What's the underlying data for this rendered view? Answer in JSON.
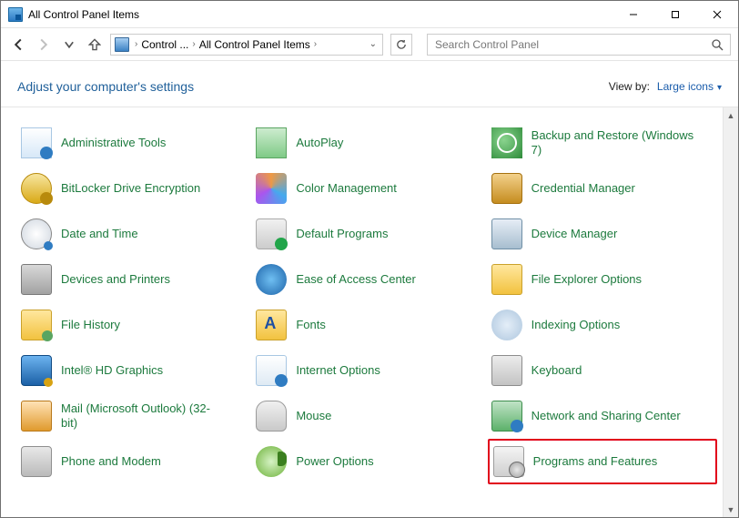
{
  "window": {
    "title": "All Control Panel Items"
  },
  "nav": {
    "crumb1": "Control ...",
    "crumb2": "All Control Panel Items"
  },
  "search": {
    "placeholder": "Search Control Panel"
  },
  "header": {
    "heading": "Adjust your computer's settings",
    "viewby_label": "View by:",
    "viewby_value": "Large icons"
  },
  "items": [
    {
      "label": "Administrative Tools",
      "icon": "i-admin"
    },
    {
      "label": "AutoPlay",
      "icon": "i-autoplay"
    },
    {
      "label": "Backup and Restore (Windows 7)",
      "icon": "i-backup"
    },
    {
      "label": "BitLocker Drive Encryption",
      "icon": "i-bitlocker"
    },
    {
      "label": "Color Management",
      "icon": "i-color"
    },
    {
      "label": "Credential Manager",
      "icon": "i-credential"
    },
    {
      "label": "Date and Time",
      "icon": "i-datetime"
    },
    {
      "label": "Default Programs",
      "icon": "i-default"
    },
    {
      "label": "Device Manager",
      "icon": "i-device"
    },
    {
      "label": "Devices and Printers",
      "icon": "i-printers"
    },
    {
      "label": "Ease of Access Center",
      "icon": "i-ease"
    },
    {
      "label": "File Explorer Options",
      "icon": "i-explorer"
    },
    {
      "label": "File History",
      "icon": "i-filehist"
    },
    {
      "label": "Fonts",
      "icon": "i-fonts"
    },
    {
      "label": "Indexing Options",
      "icon": "i-index"
    },
    {
      "label": "Intel® HD Graphics",
      "icon": "i-intel"
    },
    {
      "label": "Internet Options",
      "icon": "i-ie"
    },
    {
      "label": "Keyboard",
      "icon": "i-kbd"
    },
    {
      "label": "Mail (Microsoft Outlook) (32-bit)",
      "icon": "i-mail"
    },
    {
      "label": "Mouse",
      "icon": "i-mouse"
    },
    {
      "label": "Network and Sharing Center",
      "icon": "i-net"
    },
    {
      "label": "Phone and Modem",
      "icon": "i-phone"
    },
    {
      "label": "Power Options",
      "icon": "i-power"
    },
    {
      "label": "Programs and Features",
      "icon": "i-programs",
      "highlight": true
    }
  ]
}
